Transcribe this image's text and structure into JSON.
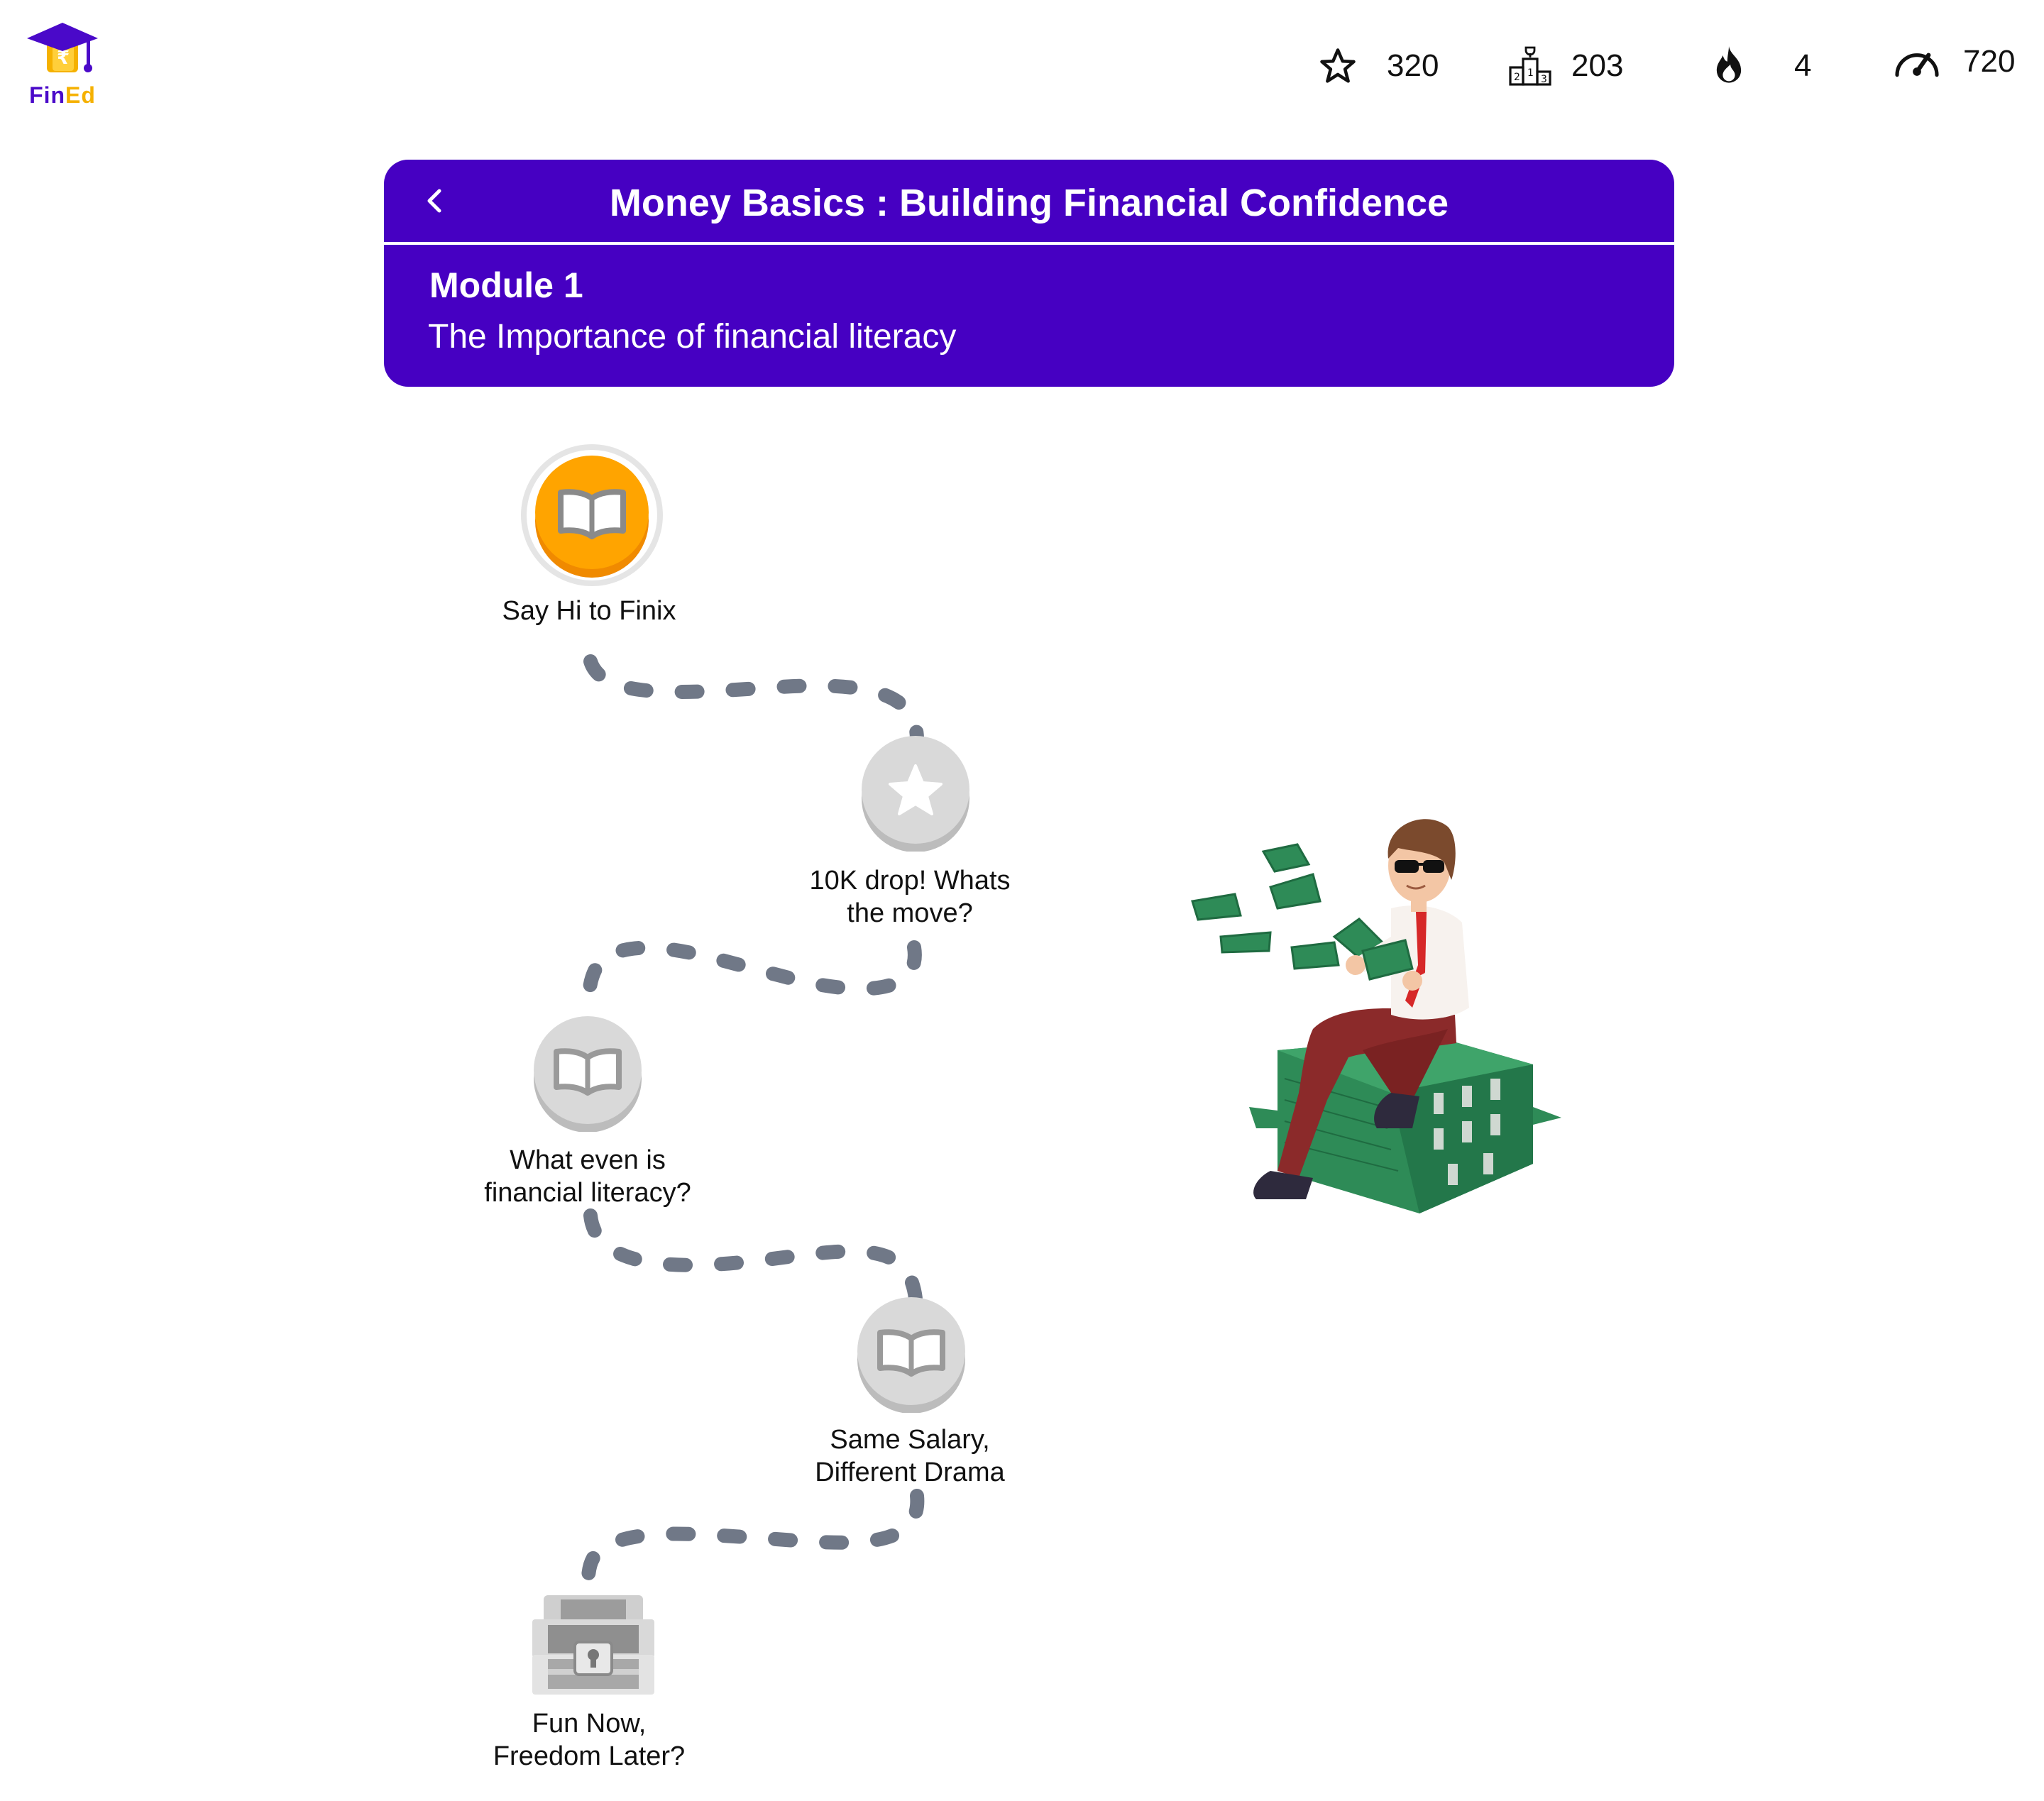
{
  "brand": {
    "name_part1": "Fin",
    "name_part2": "Ed"
  },
  "stats": {
    "stars": {
      "icon": "star-icon",
      "value": "320"
    },
    "rank": {
      "icon": "leaderboard-icon",
      "value": "203"
    },
    "streak": {
      "icon": "flame-icon",
      "value": "4"
    },
    "score": {
      "icon": "speedometer-icon",
      "value": "720"
    }
  },
  "header": {
    "back_icon": "chevron-left-icon",
    "course_title": "Money Basics : Building Financial Confidence",
    "module_label": "Module 1",
    "module_subtitle": "The Importance of financial literacy"
  },
  "lessons": [
    {
      "title_line1": "Say Hi to Finix",
      "title_line2": "",
      "icon": "book-icon",
      "state": "active"
    },
    {
      "title_line1": "10K drop! Whats",
      "title_line2": "the move?",
      "icon": "star-icon",
      "state": "locked"
    },
    {
      "title_line1": "What even is",
      "title_line2": "financial literacy?",
      "icon": "book-icon",
      "state": "locked"
    },
    {
      "title_line1": "Same Salary,",
      "title_line2": "Different Drama",
      "icon": "book-icon",
      "state": "locked"
    },
    {
      "title_line1": "Fun Now,",
      "title_line2": "Freedom Later?",
      "icon": "treasure-chest-icon",
      "state": "locked"
    }
  ],
  "colors": {
    "header_bg": "#4600c2",
    "active_node": "#ffa400",
    "locked_node": "#d9d9d9",
    "path_dash": "#707887",
    "brand_purple": "#4a09c9",
    "brand_yellow": "#f5b100"
  }
}
